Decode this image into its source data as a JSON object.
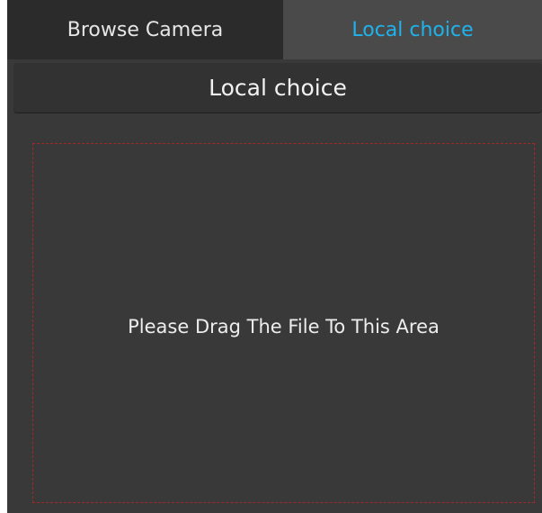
{
  "tabs": {
    "browse_label": "Browse Camera",
    "local_label": "Local choice",
    "active": "local"
  },
  "section": {
    "title": "Local choice"
  },
  "dropzone": {
    "hint": "Please Drag The File To This Area"
  },
  "colors": {
    "panel_bg": "#393939",
    "active_tab_text": "#1fb3ee",
    "dropzone_border": "#a02a2a"
  }
}
